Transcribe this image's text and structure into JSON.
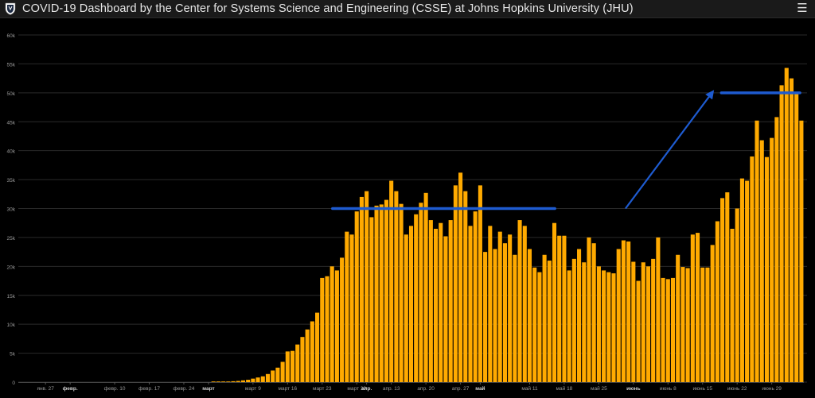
{
  "header": {
    "title": "COVID-19 Dashboard by the Center for Systems Science and Engineering (CSSE) at Johns Hopkins University (JHU)",
    "logo_icon": "jhu-shield-logo",
    "menu_icon": "hamburger-menu-icon"
  },
  "colors": {
    "bar": "#ffaa00",
    "background": "#000000",
    "header": "#1a1a1a",
    "grid": "#2a2a2a",
    "annotation": "#1e5bd0"
  },
  "chart_data": {
    "type": "bar",
    "title": "",
    "xlabel": "",
    "ylabel": "",
    "ylim": [
      0,
      60000
    ],
    "y_ticks": [
      {
        "value": 0,
        "label": "0"
      },
      {
        "value": 5000,
        "label": "5k"
      },
      {
        "value": 10000,
        "label": "10k"
      },
      {
        "value": 15000,
        "label": "15k"
      },
      {
        "value": 20000,
        "label": "20k"
      },
      {
        "value": 25000,
        "label": "25k"
      },
      {
        "value": 30000,
        "label": "30k"
      },
      {
        "value": 35000,
        "label": "35k"
      },
      {
        "value": 40000,
        "label": "40k"
      },
      {
        "value": 45000,
        "label": "45k"
      },
      {
        "value": 50000,
        "label": "50k"
      },
      {
        "value": 55000,
        "label": "55k"
      },
      {
        "value": 60000,
        "label": "60k"
      }
    ],
    "x_ticks": [
      {
        "index": 5,
        "label": "янв. 27",
        "bold": false
      },
      {
        "index": 10,
        "label": "февр.",
        "bold": true
      },
      {
        "index": 19,
        "label": "февр. 10",
        "bold": false
      },
      {
        "index": 26,
        "label": "февр. 17",
        "bold": false
      },
      {
        "index": 33,
        "label": "февр. 24",
        "bold": false
      },
      {
        "index": 38,
        "label": "март",
        "bold": true
      },
      {
        "index": 47,
        "label": "март 9",
        "bold": false
      },
      {
        "index": 54,
        "label": "март 16",
        "bold": false
      },
      {
        "index": 61,
        "label": "март 23",
        "bold": false
      },
      {
        "index": 68,
        "label": "март 30",
        "bold": false
      },
      {
        "index": 70,
        "label": "апр.",
        "bold": true
      },
      {
        "index": 75,
        "label": "апр. 13",
        "bold": false
      },
      {
        "index": 82,
        "label": "апр. 20",
        "bold": false
      },
      {
        "index": 89,
        "label": "апр. 27",
        "bold": false
      },
      {
        "index": 93,
        "label": "май",
        "bold": true
      },
      {
        "index": 103,
        "label": "май 11",
        "bold": false
      },
      {
        "index": 110,
        "label": "май 18",
        "bold": false
      },
      {
        "index": 117,
        "label": "май 25",
        "bold": false
      },
      {
        "index": 124,
        "label": "июнь",
        "bold": true
      },
      {
        "index": 131,
        "label": "июнь 8",
        "bold": false
      },
      {
        "index": 138,
        "label": "июнь 15",
        "bold": false
      },
      {
        "index": 145,
        "label": "июнь 22",
        "bold": false
      },
      {
        "index": 152,
        "label": "июнь 29",
        "bold": false
      }
    ],
    "series": [
      {
        "values": [
          0,
          0,
          0,
          0,
          0,
          0,
          0,
          0,
          0,
          0,
          0,
          0,
          0,
          0,
          0,
          0,
          0,
          0,
          0,
          0,
          0,
          0,
          0,
          0,
          0,
          0,
          0,
          0,
          0,
          0,
          0,
          0,
          0,
          0,
          0,
          0,
          0,
          0,
          0,
          60,
          80,
          90,
          100,
          150,
          200,
          300,
          400,
          600,
          800,
          1000,
          1400,
          2000,
          2500,
          3500,
          5300,
          5400,
          6500,
          7800,
          9100,
          10500,
          12000,
          18000,
          18300,
          20000,
          19300,
          21500,
          26000,
          25500,
          29500,
          32000,
          33000,
          28500,
          30500,
          30700,
          31500,
          34800,
          33000,
          30800,
          25500,
          27000,
          29000,
          31000,
          32700,
          28000,
          26500,
          27500,
          25200,
          28000,
          34000,
          36200,
          33000,
          27000,
          29500,
          34000,
          22500,
          27000,
          23000,
          26000,
          24000,
          25500,
          22000,
          28000,
          27000,
          23000,
          19800,
          19000,
          22000,
          21000,
          27500,
          25300,
          25300,
          19300,
          21300,
          23000,
          20700,
          25000,
          24000,
          20000,
          19300,
          19000,
          18800,
          23000,
          24500,
          24300,
          20800,
          17500,
          20700,
          20000,
          21300,
          25000,
          18000,
          17800,
          18000,
          22000,
          19900,
          19700,
          25500,
          25800,
          19800,
          19800,
          23700,
          27800,
          31800,
          32800,
          26500,
          30000,
          35200,
          34800,
          39000,
          45200,
          41800,
          38900,
          42200,
          45800,
          51300,
          54300,
          52500,
          50000,
          45200
        ]
      }
    ],
    "annotations": [
      {
        "type": "hline",
        "x_start_index": 63.6,
        "x_end_index": 108.6,
        "y": 30000
      },
      {
        "type": "arrow",
        "x_start_index": 122.9,
        "y_start": 30000,
        "x_end_index": 140.4,
        "y_end": 50000
      },
      {
        "type": "hline",
        "x_start_index": 142.3,
        "x_end_index": 158.2,
        "y": 50000
      }
    ],
    "grid": true,
    "legend": "none"
  }
}
